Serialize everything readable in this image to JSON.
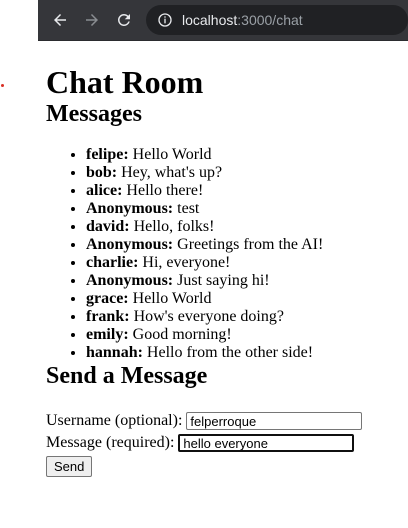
{
  "browser": {
    "url_host": "localhost",
    "url_rest": ":3000/chat"
  },
  "page": {
    "title": "Chat Room",
    "messages_heading": "Messages",
    "send_heading": "Send a Message"
  },
  "messages": [
    {
      "user": "felipe:",
      "text": " Hello World"
    },
    {
      "user": "bob:",
      "text": " Hey, what's up?"
    },
    {
      "user": "alice:",
      "text": " Hello there!"
    },
    {
      "user": "Anonymous:",
      "text": " test"
    },
    {
      "user": "david:",
      "text": " Hello, folks!"
    },
    {
      "user": "Anonymous:",
      "text": " Greetings from the AI!"
    },
    {
      "user": "charlie:",
      "text": " Hi, everyone!"
    },
    {
      "user": "Anonymous:",
      "text": " Just saying hi!"
    },
    {
      "user": "grace:",
      "text": " Hello World"
    },
    {
      "user": "frank:",
      "text": " How's everyone doing?"
    },
    {
      "user": "emily:",
      "text": " Good morning!"
    },
    {
      "user": "hannah:",
      "text": " Hello from the other side!"
    }
  ],
  "form": {
    "username_label": "Username (optional):",
    "username_value": "felperroque",
    "message_label": "Message (required):",
    "message_value": "hello everyone",
    "send_label": "Send"
  },
  "colors": {
    "chrome_bg": "#35363a",
    "omnibox_bg": "#202124",
    "url_dim": "#9aa0a6",
    "focus_border": "#101010",
    "stray_dot": "#d93025"
  },
  "icons": {
    "back": "arrow-left-icon",
    "forward": "arrow-right-icon",
    "reload": "reload-icon",
    "site_info": "site-info-icon"
  }
}
